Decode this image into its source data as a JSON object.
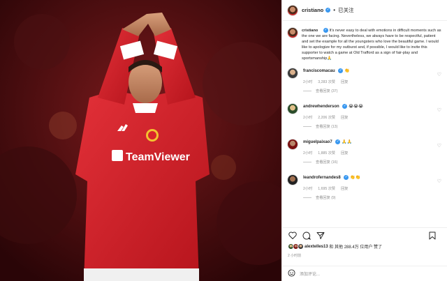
{
  "post": {
    "author": "cristiano",
    "verified_mark": "✓",
    "separator": "•",
    "follow_status": "已关注",
    "caption": "It's never easy to deal with emotions in difficult moments such as the one we are facing. Nevertheless, we always have to be respectful, patient and set the example for all the youngsters who love the beautiful game. I would like to apologize for my outburst and, if possible, I would like to invite this supporter to watch a game at Old Trafford as a sign of fair-play and sportsmanship🙏"
  },
  "photo": {
    "shirt_sponsor": "TeamViewer",
    "colors": {
      "shirt": "#d9232b",
      "background": "#4a0d10"
    }
  },
  "comments": [
    {
      "user": "franciscomacau",
      "text": "👏",
      "time": "2小时",
      "likes": "3,283 次赞",
      "reply": "回复",
      "view_replies": "查看回复 (37)"
    },
    {
      "user": "andrewhenderson",
      "text": "😭😭😭",
      "time": "2小时",
      "likes": "2,206 次赞",
      "reply": "回复",
      "view_replies": "查看回复 (13)"
    },
    {
      "user": "miguelpaixao7",
      "text": "🙏🙏",
      "time": "2小时",
      "likes": "1,885 次赞",
      "reply": "回复",
      "view_replies": "查看回复 (16)"
    },
    {
      "user": "leandrofernandes8",
      "text": "👏👏",
      "time": "2小时",
      "likes": "1,695 次赞",
      "reply": "回复",
      "view_replies": "查看回复 (9)"
    }
  ],
  "likes_summary": {
    "user": "alextelles13",
    "text": "和 其他 288.4万 位用户 赞了"
  },
  "timestamp": "2 小时前",
  "add_comment": {
    "placeholder": "添加评论..."
  },
  "icons": {
    "like": "heart-icon",
    "comment": "comment-icon",
    "share": "share-icon",
    "save": "bookmark-icon",
    "emoji": "emoji-icon"
  }
}
